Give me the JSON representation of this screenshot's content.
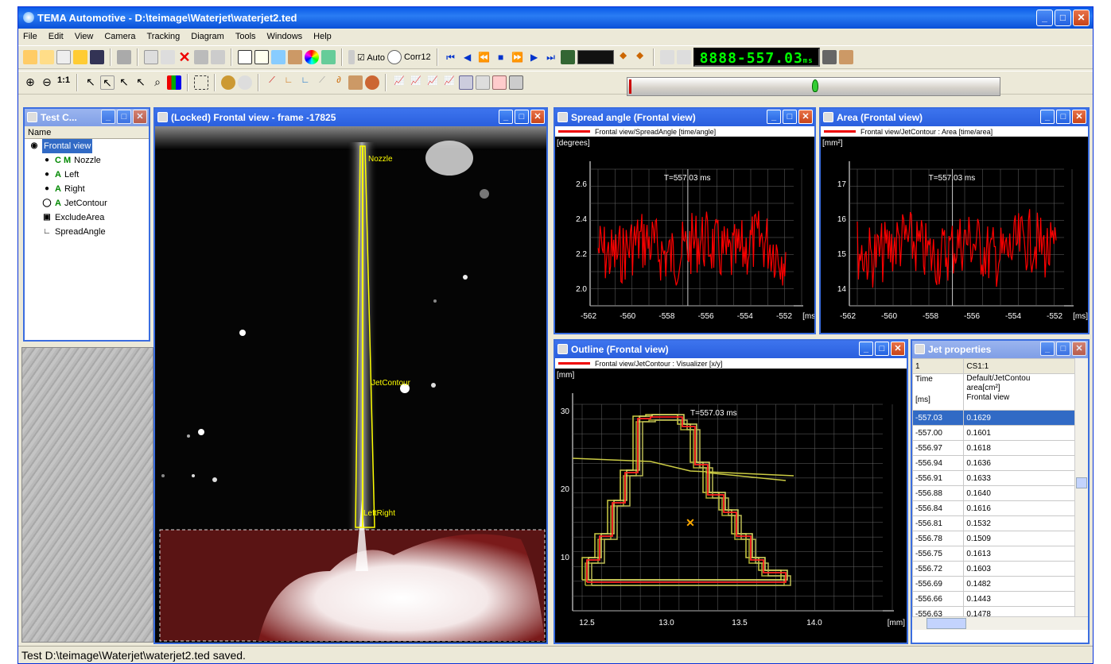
{
  "app": {
    "title": "TEMA Automotive - D:\\teimage\\Waterjet\\waterjet2.ted",
    "status": "Test D:\\teimage\\Waterjet\\waterjet2.ted saved."
  },
  "menu": [
    "File",
    "Edit",
    "View",
    "Camera",
    "Tracking",
    "Diagram",
    "Tools",
    "Windows",
    "Help"
  ],
  "toolbar": {
    "auto_label": "Auto",
    "corr_label": "Corr12",
    "time_display": "8888-557.03",
    "time_unit": "ms"
  },
  "tree_pane": {
    "title": "Test C...",
    "header": "Name",
    "items": [
      {
        "label": "Frontal view",
        "icon": "camera-icon",
        "selected": true
      },
      {
        "label": "Nozzle",
        "icon": "point-icon",
        "prefix": "C M"
      },
      {
        "label": "Left",
        "icon": "point-icon",
        "prefix": "A"
      },
      {
        "label": "Right",
        "icon": "point-icon",
        "prefix": "A"
      },
      {
        "label": "JetContour",
        "icon": "contour-icon",
        "prefix": "A"
      },
      {
        "label": "ExcludeArea",
        "icon": "exclude-icon"
      },
      {
        "label": "SpreadAngle",
        "icon": "angle-icon"
      }
    ]
  },
  "frontal": {
    "title": "(Locked) Frontal view - frame -17825",
    "labels": {
      "nozzle": "Nozzle",
      "jetcontour": "JetContour",
      "leftright": "LeftRight"
    }
  },
  "spread": {
    "title": "Spread angle (Frontal view)",
    "legend": "Frontal view/SpreadAngle [time/angle]",
    "yunit": "[degrees]",
    "xunit": "[ms]",
    "marker": "T=557.03 ms",
    "yticks": [
      "2.6",
      "2.4",
      "2.2",
      "2.0"
    ],
    "xticks": [
      "-562",
      "-560",
      "-558",
      "-556",
      "-554",
      "-552"
    ]
  },
  "area": {
    "title": "Area (Frontal view)",
    "legend": "Frontal view/JetContour : Area [time/area]",
    "yunit": "[mm²]",
    "xunit": "[ms]",
    "marker": "T=557.03 ms",
    "yticks": [
      "17",
      "16",
      "15",
      "14"
    ],
    "xticks": [
      "-562",
      "-560",
      "-558",
      "-556",
      "-554",
      "-552"
    ]
  },
  "outline": {
    "title": "Outline (Frontal view)",
    "legend": "Frontal view/JetContour : Visualizer [x/y]",
    "yunit": "[mm]",
    "xunit": "[mm]",
    "marker": "T=557.03 ms",
    "yticks": [
      "30",
      "20",
      "10"
    ],
    "xticks": [
      "12.5",
      "13.0",
      "13.5",
      "14.0"
    ]
  },
  "jet": {
    "title": "Jet properties",
    "header": [
      "1",
      "CS1:1"
    ],
    "subhead": {
      "c1": "Time",
      "c1b": "[ms]",
      "c2a": "Default/JetContou",
      "c2b": "area[cm²]",
      "c2c": "Frontal view"
    },
    "rows": [
      [
        "-557.03",
        "0.1629"
      ],
      [
        "-557.00",
        "0.1601"
      ],
      [
        "-556.97",
        "0.1618"
      ],
      [
        "-556.94",
        "0.1636"
      ],
      [
        "-556.91",
        "0.1633"
      ],
      [
        "-556.88",
        "0.1640"
      ],
      [
        "-556.84",
        "0.1616"
      ],
      [
        "-556.81",
        "0.1532"
      ],
      [
        "-556.78",
        "0.1509"
      ],
      [
        "-556.75",
        "0.1613"
      ],
      [
        "-556.72",
        "0.1603"
      ],
      [
        "-556.69",
        "0.1482"
      ],
      [
        "-556.66",
        "0.1443"
      ],
      [
        "-556.63",
        "0.1478"
      ]
    ]
  },
  "colors": {
    "accent": "#316ac5",
    "signal": "#ff0000",
    "overlay": "#ffff00"
  }
}
